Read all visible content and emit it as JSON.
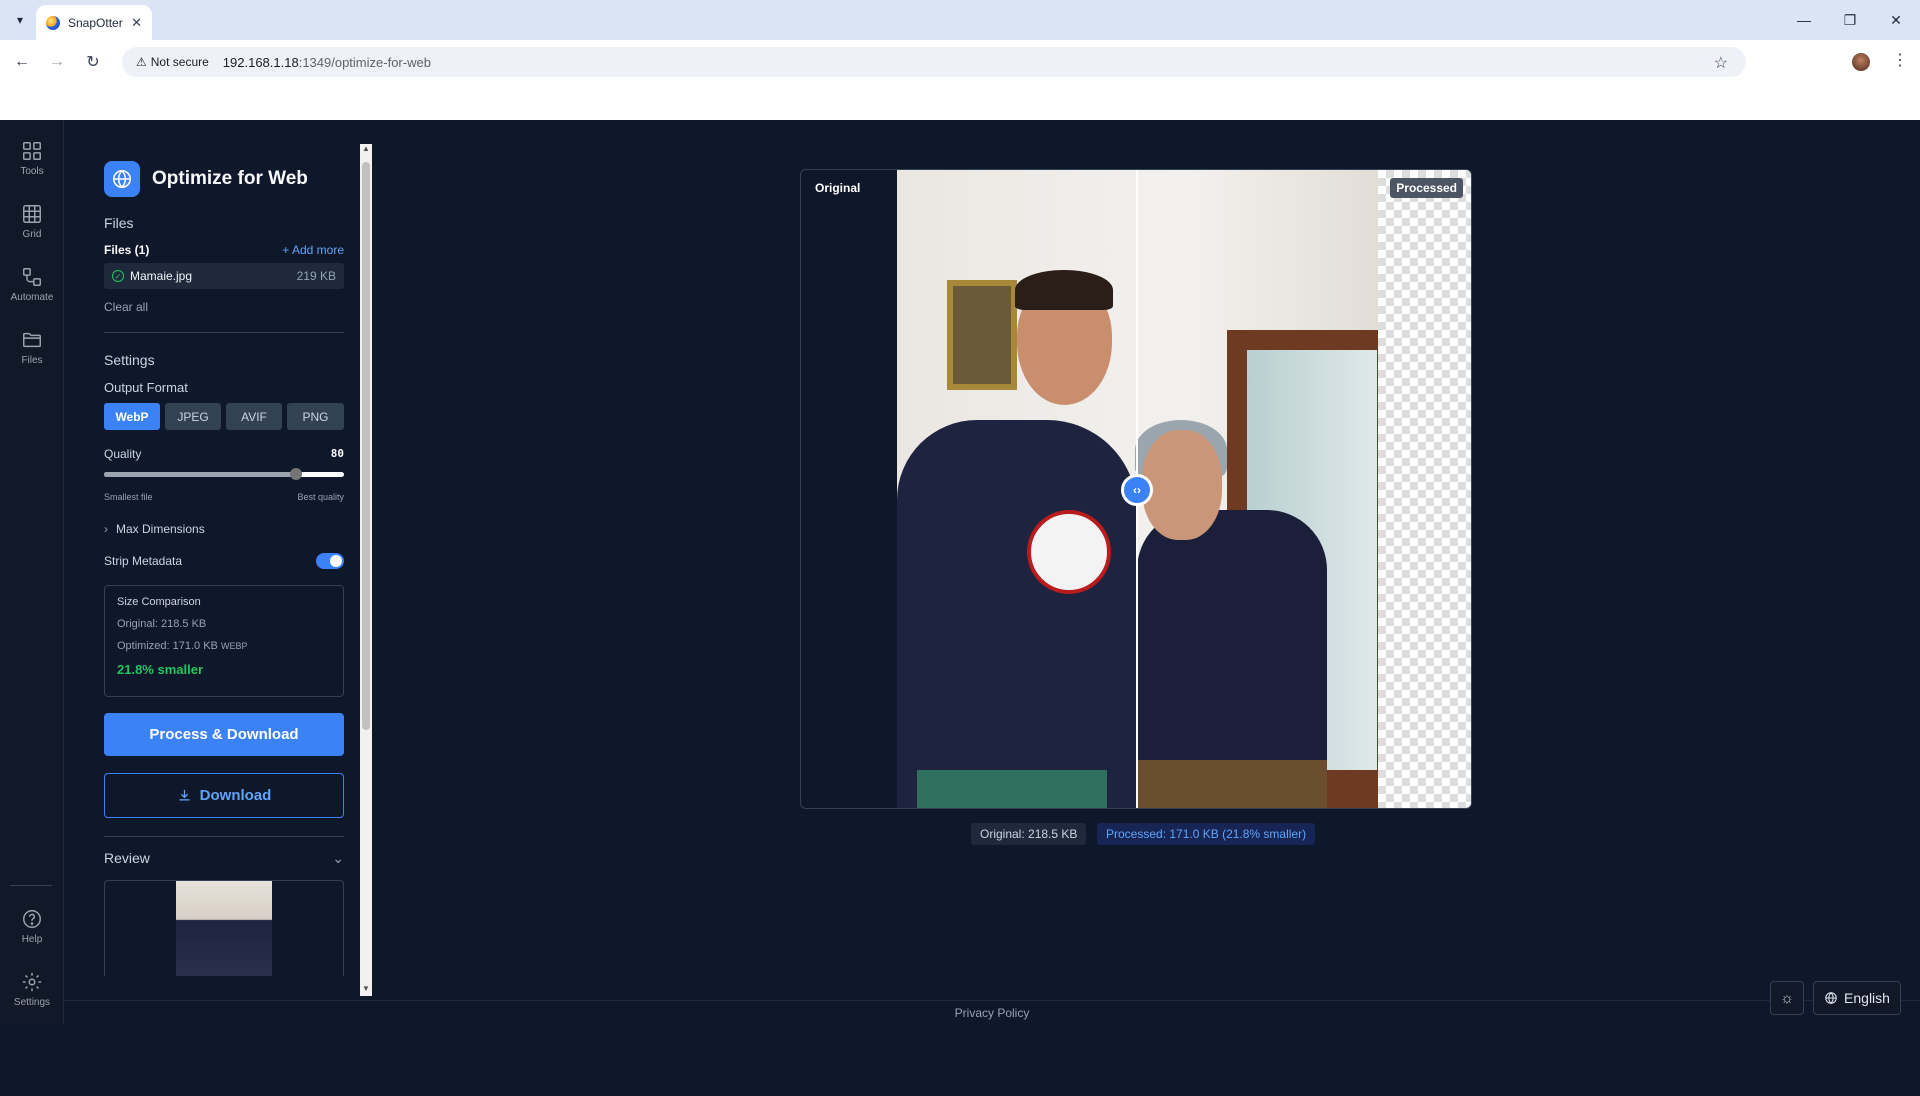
{
  "browser": {
    "tab_title": "SnapOtter",
    "security_label": "Not secure",
    "url_host": "192.168.1.18",
    "url_path": ":1349/optimize-for-web"
  },
  "rail": {
    "items": [
      {
        "label": "Tools",
        "icon": "tools-grid-icon"
      },
      {
        "label": "Grid",
        "icon": "grid-icon"
      },
      {
        "label": "Automate",
        "icon": "automate-icon"
      },
      {
        "label": "Files",
        "icon": "folder-icon"
      }
    ],
    "bottom": [
      {
        "label": "Help",
        "icon": "help-icon"
      },
      {
        "label": "Settings",
        "icon": "gear-icon"
      }
    ]
  },
  "panel": {
    "title": "Optimize for Web",
    "files_heading": "Files",
    "files_count": "Files (1)",
    "add_more": "+ Add more",
    "file": {
      "name": "Mamaie.jpg",
      "size": "219 KB"
    },
    "clear_all": "Clear all",
    "settings_heading": "Settings",
    "output_format_label": "Output Format",
    "formats": [
      "WebP",
      "JPEG",
      "AVIF",
      "PNG"
    ],
    "selected_format": "WebP",
    "quality_label": "Quality",
    "quality_value": "80",
    "quality_fraction": 0.8,
    "quality_min_hint": "Smallest file",
    "quality_max_hint": "Best quality",
    "max_dimensions": "Max Dimensions",
    "strip_metadata": "Strip Metadata",
    "strip_metadata_on": true,
    "size_comparison": {
      "title": "Size Comparison",
      "original": "Original: 218.5 KB",
      "optimized": "Optimized: 171.0 KB",
      "optimized_format": "WEBP",
      "reduction": "21.8% smaller"
    },
    "process_button": "Process & Download",
    "download_button": "Download",
    "review_heading": "Review"
  },
  "compare": {
    "label_original": "Original",
    "label_processed": "Processed",
    "stat_original": "Original: 218.5 KB",
    "stat_processed": "Processed: 171.0 KB (21.8% smaller)"
  },
  "footer": {
    "privacy": "Privacy Policy",
    "language": "English"
  },
  "colors": {
    "accent": "#3b82f6",
    "background": "#0f172a",
    "success": "#22c55e"
  }
}
